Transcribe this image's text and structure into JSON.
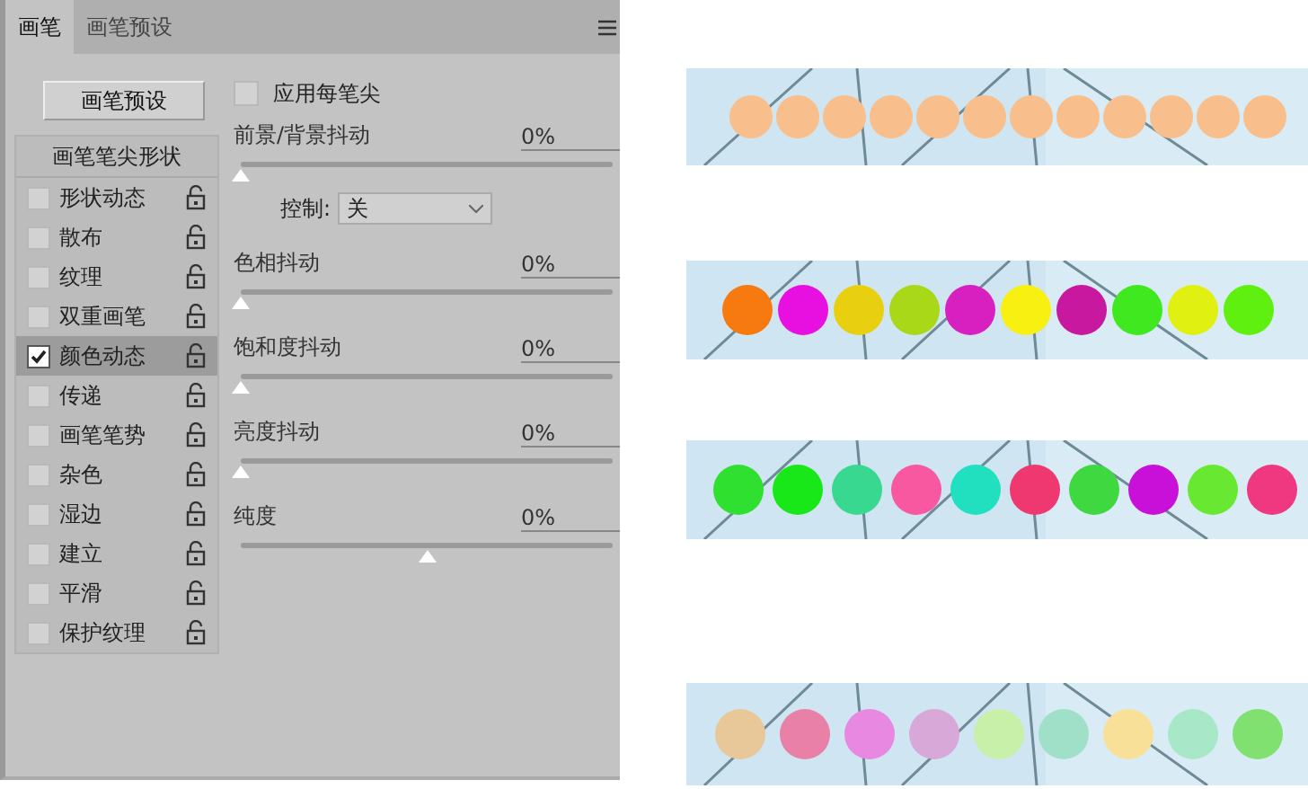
{
  "tabs": [
    {
      "label": "画笔",
      "selected": true
    },
    {
      "label": "画笔预设",
      "selected": false
    }
  ],
  "presets_button": "画笔预设",
  "brush_tip_shape": "画笔笔尖形状",
  "options": [
    {
      "label": "形状动态",
      "checked": false,
      "selected": false
    },
    {
      "label": "散布",
      "checked": false,
      "selected": false
    },
    {
      "label": "纹理",
      "checked": false,
      "selected": false
    },
    {
      "label": "双重画笔",
      "checked": false,
      "selected": false
    },
    {
      "label": "颜色动态",
      "checked": true,
      "selected": true
    },
    {
      "label": "传递",
      "checked": false,
      "selected": false
    },
    {
      "label": "画笔笔势",
      "checked": false,
      "selected": false
    },
    {
      "label": "杂色",
      "checked": false,
      "selected": false
    },
    {
      "label": "湿边",
      "checked": false,
      "selected": false
    },
    {
      "label": "建立",
      "checked": false,
      "selected": false
    },
    {
      "label": "平滑",
      "checked": false,
      "selected": false
    },
    {
      "label": "保护纹理",
      "checked": false,
      "selected": false
    }
  ],
  "apply_per_tip": {
    "label": "应用每笔尖",
    "checked": false
  },
  "jitters": [
    {
      "label": "前景/背景抖动",
      "value": "0%",
      "level": 0,
      "control": {
        "label": "控制:",
        "value": "关"
      }
    },
    {
      "label": "色相抖动",
      "value": "0%",
      "level": 0
    },
    {
      "label": "饱和度抖动",
      "value": "0%",
      "level": 0
    },
    {
      "label": "亮度抖动",
      "value": "0%",
      "level": 0
    },
    {
      "label": "纯度",
      "value": "0%",
      "level": 0.5
    }
  ]
}
